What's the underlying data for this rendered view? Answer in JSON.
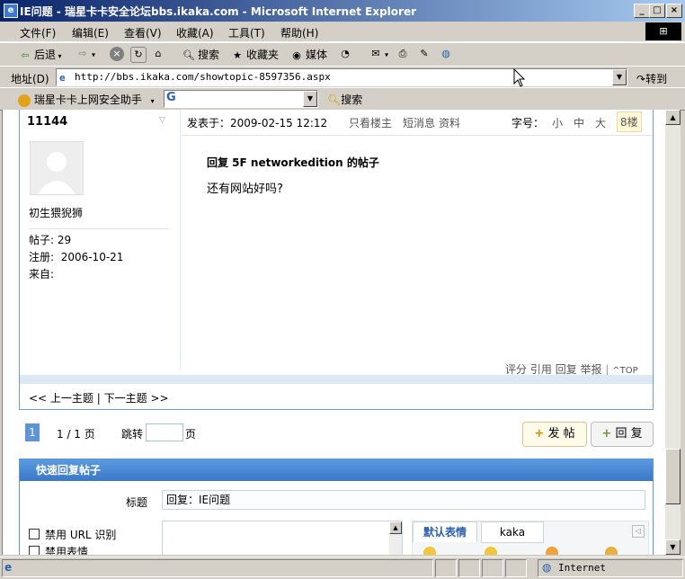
{
  "window": {
    "title": "IE问题 - 瑞星卡卡安全论坛bbs.ikaka.com - Microsoft Internet Explorer",
    "icon_label": "e",
    "min_label": "_",
    "max_label": "□",
    "close_label": "×"
  },
  "menu": [
    "文件(F)",
    "编辑(E)",
    "查看(V)",
    "收藏(A)",
    "工具(T)",
    "帮助(H)"
  ],
  "toolbar": {
    "back": "后退",
    "search": "搜索",
    "favorites": "收藏夹",
    "media": "媒体"
  },
  "address": {
    "label": "地址(D)",
    "url": "http://bbs.ikaka.com/showtopic-8597356.aspx",
    "go": "转到"
  },
  "helper": {
    "name": "瑞星卡卡上网安全助手",
    "g_label": "G",
    "search": "搜索"
  },
  "post": {
    "author": "11144",
    "posted_at_label": "发表于：",
    "posted_at": "2009-02-15 12:12",
    "actions": [
      "只看楼主",
      "短消息",
      "资料"
    ],
    "fontsize_label": "字号：",
    "fontsizes": [
      "小",
      "中",
      "大"
    ],
    "floor": "8楼",
    "rank": "初生猥猊狮",
    "stats": [
      {
        "label": "帖子:",
        "value": "29"
      },
      {
        "label": "注册:",
        "value": "2006-10-21"
      },
      {
        "label": "来自:",
        "value": ""
      }
    ],
    "reply_title": "回复 5F networkedition 的帖子",
    "content": "还有网站好吗?",
    "footer_links": [
      "评分",
      "引用",
      "回复",
      "举报"
    ],
    "top_label": "TOP"
  },
  "nav": {
    "prev": "<< 上一主题",
    "sep": "|",
    "next": "下一主题 >>"
  },
  "pager": {
    "current": "1",
    "summary": "1 / 1 页",
    "jump_label": "跳转",
    "page_suffix": "页",
    "post_button": "发 帖",
    "reply_button": "回 复"
  },
  "quick_reply": {
    "title": "快速回复帖子",
    "subject_label": "标题",
    "subject_value": "回复：IE问题",
    "options": [
      "禁用 URL 识别",
      "禁用表情"
    ],
    "tabs": [
      "默认表情",
      "kaka"
    ]
  },
  "status": {
    "zone": "Internet"
  }
}
